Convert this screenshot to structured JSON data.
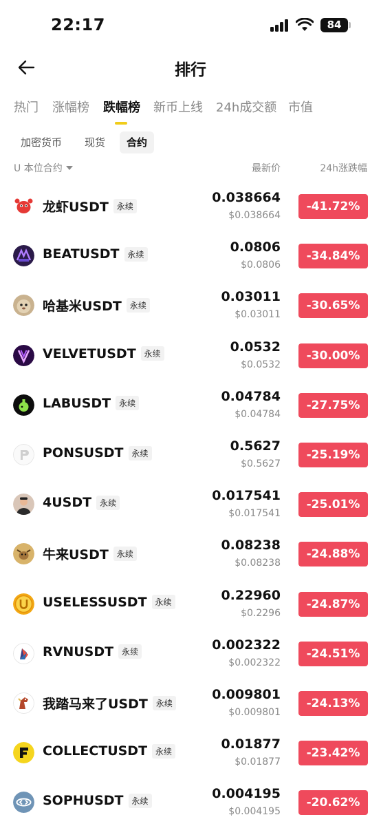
{
  "status_bar": {
    "time": "22:17",
    "battery": "84"
  },
  "header": {
    "title": "排行"
  },
  "tabs": [
    {
      "label": "热门"
    },
    {
      "label": "涨幅榜"
    },
    {
      "label": "跌幅榜"
    },
    {
      "label": "新币上线"
    },
    {
      "label": "24h成交额"
    },
    {
      "label": "市值"
    }
  ],
  "active_tab": "跌幅榜",
  "subtabs": [
    {
      "label": "加密货币"
    },
    {
      "label": "现货"
    },
    {
      "label": "合约"
    }
  ],
  "active_subtab": "合约",
  "columns": {
    "filter": "U 本位合约",
    "price": "最新价",
    "change": "24h涨跌幅"
  },
  "colors": {
    "negative": "#ef4a5c",
    "accent": "#f0cc1a"
  },
  "rows": [
    {
      "name": "龙虾USDT",
      "badge": "永续",
      "price": "0.038664",
      "price_usd": "$0.038664",
      "change": "-41.72%",
      "icon": "lobster-icon"
    },
    {
      "name": "BEATUSDT",
      "badge": "永续",
      "price": "0.0806",
      "price_usd": "$0.0806",
      "change": "-34.84%",
      "icon": "beat-logo-icon"
    },
    {
      "name": "哈基米USDT",
      "badge": "永续",
      "price": "0.03011",
      "price_usd": "$0.03011",
      "change": "-30.65%",
      "icon": "cat-face-icon"
    },
    {
      "name": "VELVETUSDT",
      "badge": "永续",
      "price": "0.0532",
      "price_usd": "$0.0532",
      "change": "-30.00%",
      "icon": "velvet-logo-icon"
    },
    {
      "name": "LABUSDT",
      "badge": "永续",
      "price": "0.04784",
      "price_usd": "$0.04784",
      "change": "-27.75%",
      "icon": "flask-icon"
    },
    {
      "name": "PONSUSDT",
      "badge": "永续",
      "price": "0.5627",
      "price_usd": "$0.5627",
      "change": "-25.19%",
      "icon": "pons-logo-icon"
    },
    {
      "name": "4USDT",
      "badge": "永续",
      "price": "0.017541",
      "price_usd": "$0.017541",
      "change": "-25.01%",
      "icon": "person-avatar-icon"
    },
    {
      "name": "牛来USDT",
      "badge": "永续",
      "price": "0.08238",
      "price_usd": "$0.08238",
      "change": "-24.88%",
      "icon": "bull-icon"
    },
    {
      "name": "USELESSUSDT",
      "badge": "永续",
      "price": "0.22960",
      "price_usd": "$0.2296",
      "change": "-24.87%",
      "icon": "useless-coin-icon"
    },
    {
      "name": "RVNUSDT",
      "badge": "永续",
      "price": "0.002322",
      "price_usd": "$0.002322",
      "change": "-24.51%",
      "icon": "raven-icon"
    },
    {
      "name": "我踏马来了USDT",
      "badge": "永续",
      "price": "0.009801",
      "price_usd": "$0.009801",
      "change": "-24.13%",
      "icon": "horse-icon"
    },
    {
      "name": "COLLECTUSDT",
      "badge": "永续",
      "price": "0.01877",
      "price_usd": "$0.01877",
      "change": "-23.42%",
      "icon": "collect-logo-icon"
    },
    {
      "name": "SOPHUSDT",
      "badge": "永续",
      "price": "0.004195",
      "price_usd": "$0.004195",
      "change": "-20.62%",
      "icon": "soph-logo-icon"
    }
  ]
}
